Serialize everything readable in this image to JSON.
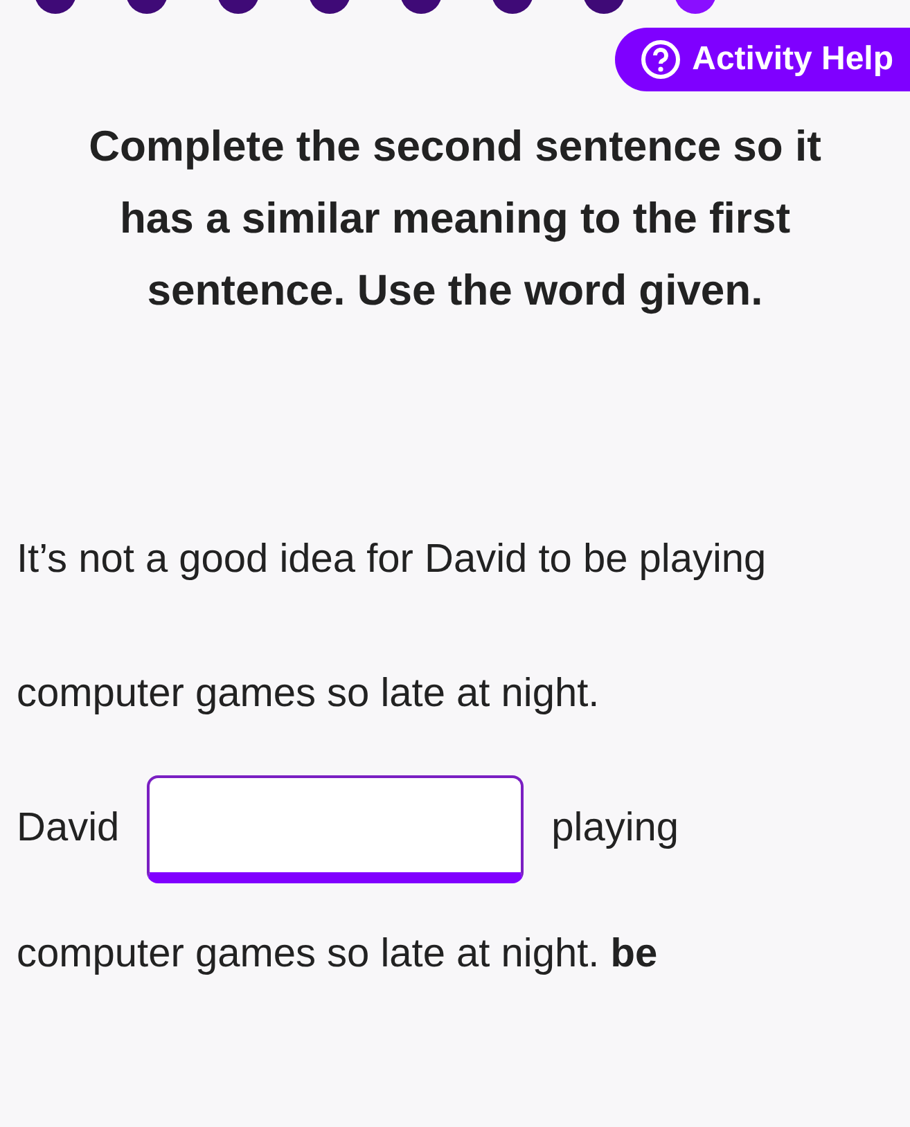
{
  "progress": [
    {
      "selected": false
    },
    {
      "selected": false
    },
    {
      "selected": false
    },
    {
      "selected": false
    },
    {
      "selected": false
    },
    {
      "selected": false
    },
    {
      "selected": false
    },
    {
      "selected": true
    }
  ],
  "help_button": {
    "label": "Activity Help"
  },
  "instructions": "Complete the second sentence so it has a similar meaning to the first sentence. Use the word given.",
  "first_sentence": "It’s not a good idea for David to be playing computer games so late at night.",
  "second_sentence": {
    "before": "David",
    "after": "playing computer games so late at night.",
    "keyword": "be"
  }
}
